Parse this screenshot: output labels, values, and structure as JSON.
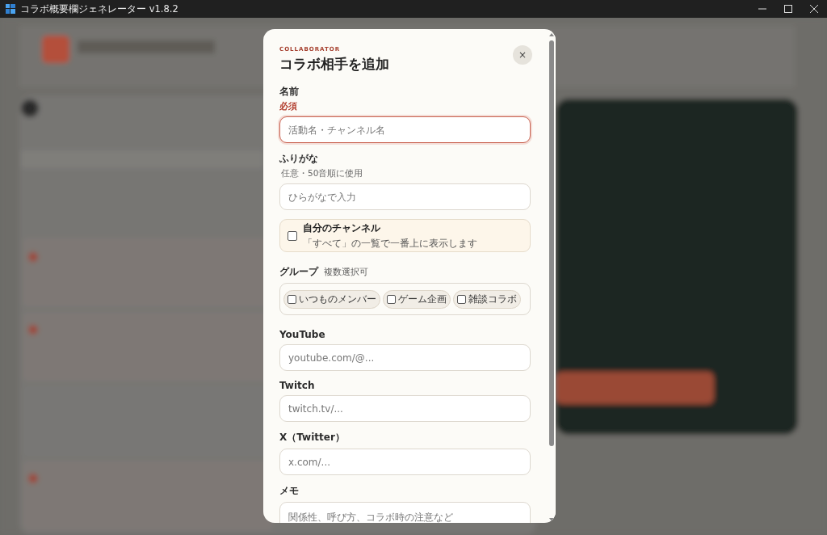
{
  "window": {
    "title": "コラボ概要欄ジェネレーター v1.8.2"
  },
  "dialog": {
    "eyebrow": "COLLABORATOR",
    "title": "コラボ相手を追加",
    "close": "×",
    "fields": [
      {
        "kind": "text",
        "label": "名前",
        "note": "必須",
        "required": true,
        "focused": true,
        "placeholder": "活動名・チャンネル名"
      },
      {
        "kind": "text",
        "label": "ふりがな",
        "note": "任意・50音順に使用",
        "required": false,
        "focused": false,
        "placeholder": "ひらがなで入力"
      },
      {
        "kind": "checkbox",
        "label": "自分のチャンネル",
        "hint": "「すべて」の一覧で一番上に表示します",
        "checked": false
      },
      {
        "kind": "chips",
        "label": "グループ",
        "note": "複数選択可",
        "options": [
          {
            "label": "いつものメンバー",
            "checked": false
          },
          {
            "label": "ゲーム企画",
            "checked": false
          },
          {
            "label": "雑談コラボ",
            "checked": false
          }
        ]
      },
      {
        "kind": "text",
        "label": "YouTube",
        "focused": false,
        "placeholder": "youtube.com/@..."
      },
      {
        "kind": "text",
        "label": "Twitch",
        "focused": false,
        "placeholder": "twitch.tv/..."
      },
      {
        "kind": "text",
        "label": "X（Twitter）",
        "focused": false,
        "placeholder": "x.com/..."
      },
      {
        "kind": "textarea",
        "label": "メモ",
        "focused": false,
        "placeholder": "関係性、呼び方、コラボ時の注意など"
      }
    ]
  }
}
